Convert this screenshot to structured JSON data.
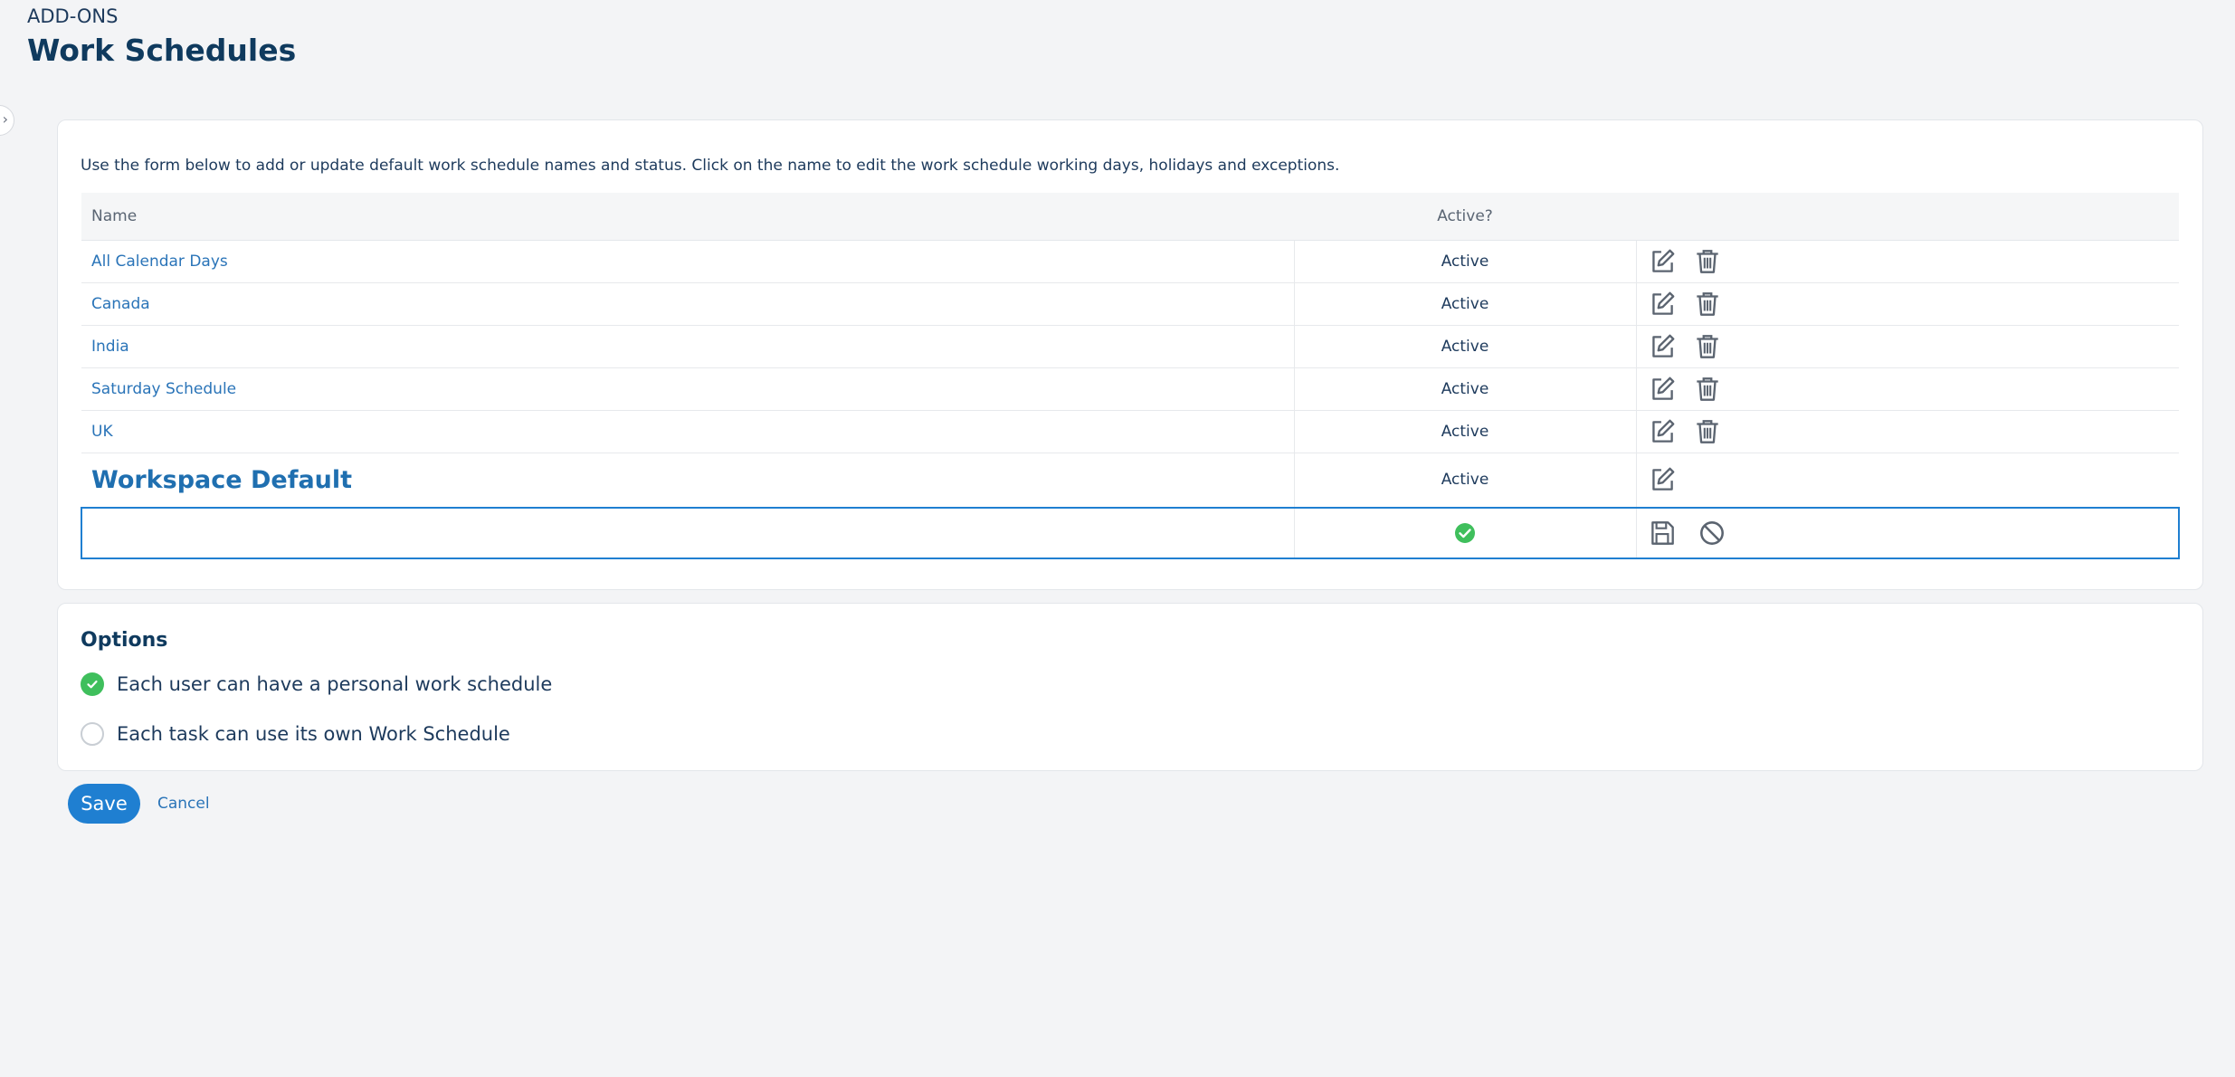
{
  "header": {
    "breadcrumb": "ADD-ONS",
    "title": "Work Schedules"
  },
  "schedules": {
    "intro": "Use the form below to add or update default work schedule names and status. Click on the name to edit the work schedule working days, holidays and exceptions.",
    "columns": {
      "name": "Name",
      "active": "Active?",
      "actions": ""
    },
    "rows": [
      {
        "name": "All Calendar Days",
        "status": "Active",
        "actions": [
          "edit-icon",
          "trash-icon"
        ]
      },
      {
        "name": "Canada",
        "status": "Active",
        "actions": [
          "edit-icon",
          "trash-icon"
        ]
      },
      {
        "name": "India",
        "status": "Active",
        "actions": [
          "edit-icon",
          "trash-icon"
        ]
      },
      {
        "name": "Saturday Schedule",
        "status": "Active",
        "actions": [
          "edit-icon",
          "trash-icon"
        ]
      },
      {
        "name": "UK",
        "status": "Active",
        "actions": [
          "edit-icon",
          "trash-icon"
        ]
      },
      {
        "name": "Workspace Default",
        "status": "Active",
        "actions": [
          "edit-icon"
        ]
      }
    ],
    "new_row": {
      "name_value": "",
      "active_checked": true,
      "actions": [
        "save-icon",
        "cancel-circle-icon"
      ]
    }
  },
  "options": {
    "title": "Options",
    "items": [
      {
        "label": "Each user can have a personal work schedule",
        "checked": true
      },
      {
        "label": "Each task can use its own Work Schedule",
        "checked": false
      }
    ]
  },
  "footer": {
    "save_label": "Save",
    "cancel_label": "Cancel"
  },
  "colors": {
    "accent": "#1f7fd1",
    "link": "#2a74b8",
    "success": "#3fbf5c",
    "heading": "#0f3a5e"
  }
}
